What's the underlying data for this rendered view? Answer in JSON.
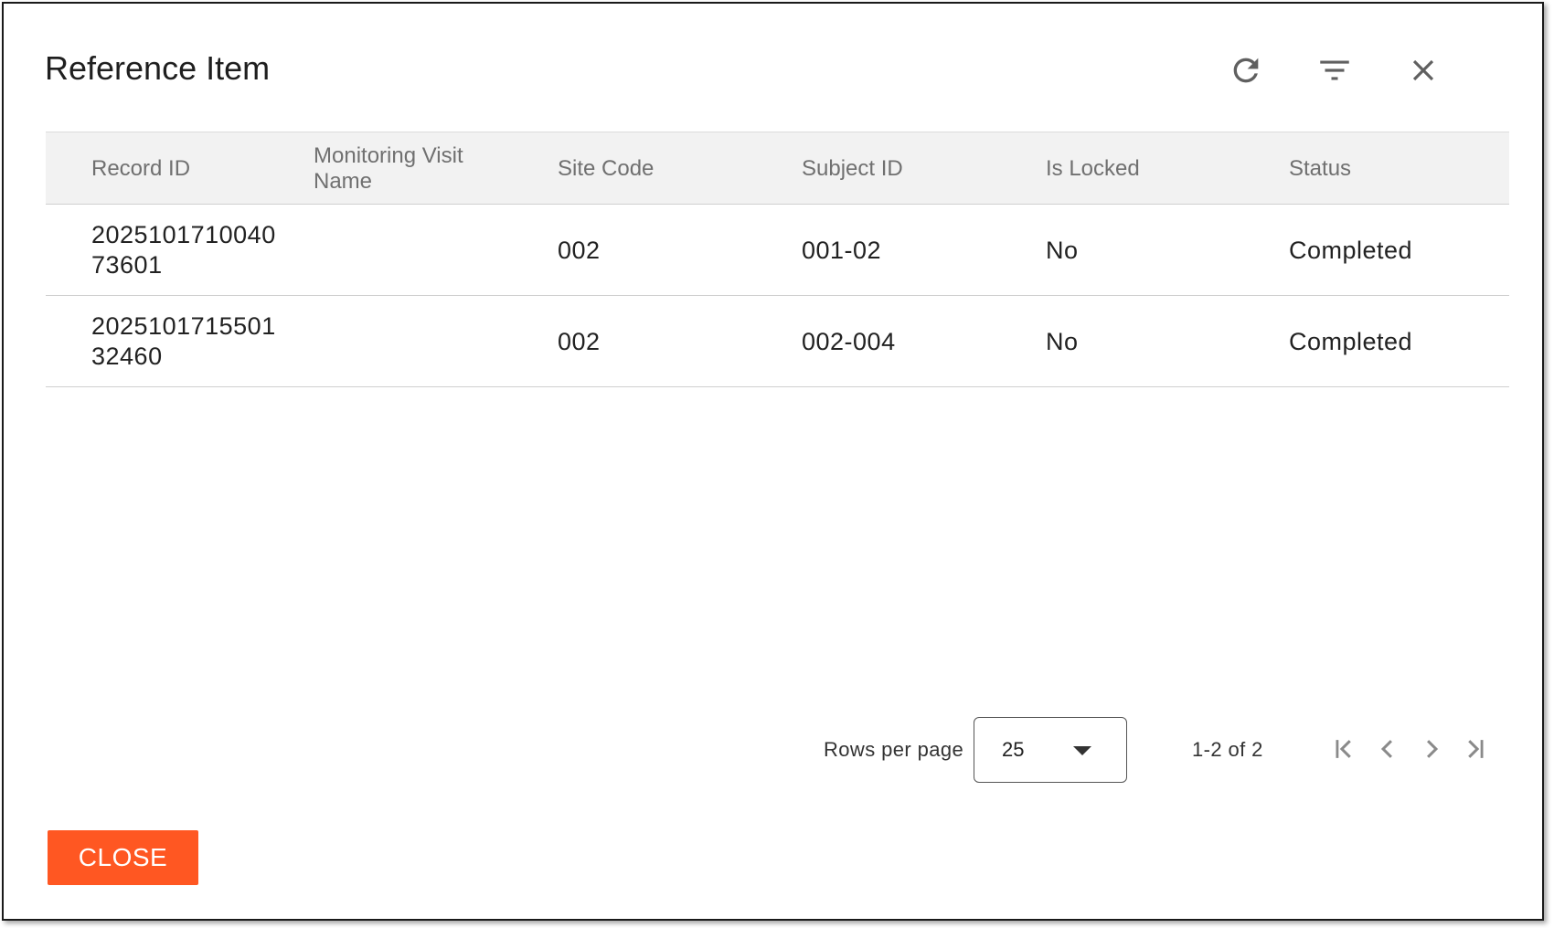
{
  "dialog": {
    "title": "Reference Item"
  },
  "toolbar": {
    "refresh_icon": "refresh-icon",
    "filter_icon": "filter-icon",
    "close_icon": "close-icon"
  },
  "table": {
    "columns": [
      "Record ID",
      "Monitoring Visit Name",
      "Site Code",
      "Subject ID",
      "Is Locked",
      "Status"
    ],
    "rows": [
      [
        "202510171004073601",
        "",
        "002",
        "001-02",
        "No",
        "Completed"
      ],
      [
        "202510171550132460",
        "",
        "002",
        "002-004",
        "No",
        "Completed"
      ]
    ]
  },
  "pagination": {
    "rows_per_page_label": "Rows per page",
    "rows_per_page_value": "25",
    "range_text": "1-2 of 2"
  },
  "footer": {
    "close_label": "CLOSE"
  },
  "colors": {
    "accent": "#ff5722",
    "header_bg": "#f2f2f2"
  }
}
